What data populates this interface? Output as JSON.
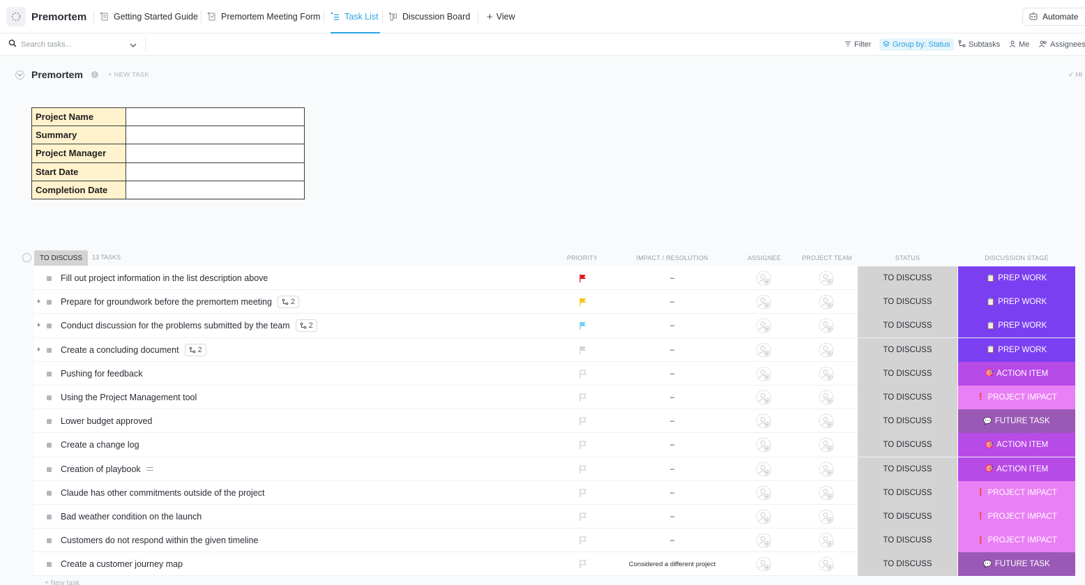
{
  "app": {
    "space_name": "Premortem",
    "tabs": [
      {
        "label": "Getting Started Guide",
        "icon": "doc-icon"
      },
      {
        "label": "Premortem Meeting Form",
        "icon": "form-icon"
      },
      {
        "label": "Task List",
        "icon": "list-icon",
        "active": true
      },
      {
        "label": "Discussion Board",
        "icon": "board-icon"
      }
    ],
    "add_view_label": "View",
    "automate_label": "Automate"
  },
  "toolbar": {
    "search_placeholder": "Search tasks...",
    "filter_label": "Filter",
    "group_by_label": "Group by: Status",
    "subtasks_label": "Subtasks",
    "me_label": "Me",
    "assignees_label": "Assignees"
  },
  "list": {
    "title": "Premortem",
    "new_task_label": "+ NEW TASK",
    "hide_label": "HI",
    "description_table": [
      {
        "label": "Project Name",
        "value": ""
      },
      {
        "label": "Summary",
        "value": ""
      },
      {
        "label": "Project Manager",
        "value": ""
      },
      {
        "label": "Start Date",
        "value": ""
      },
      {
        "label": "Completion Date",
        "value": ""
      }
    ]
  },
  "group": {
    "name": "TO DISCUSS",
    "count_label": "13 TASKS",
    "status_color": "#d3d3d3",
    "columns": {
      "priority": "PRIORITY",
      "impact": "IMPACT / RESOLUTION",
      "assignee": "ASSIGNEE",
      "team": "PROJECT TEAM",
      "status": "STATUS",
      "stage": "DISCUSSION STAGE"
    },
    "new_task_label": "+ New task"
  },
  "stage_styles": {
    "PREP WORK": {
      "color": "#7b3ff2",
      "icon": "📋"
    },
    "ACTION ITEM": {
      "color": "#b84ae8",
      "icon": "🎯"
    },
    "PROJECT IMPACT": {
      "color": "#ea80f5",
      "icon": "❗"
    },
    "FUTURE TASK": {
      "color": "#9b59b6",
      "icon": "💬"
    }
  },
  "priority_colors": {
    "urgent": "#e11d1d",
    "high": "#f5c518",
    "normal": "#6fd4f5",
    "low": "#d0d4da",
    "none": "#c4c9d0"
  },
  "tasks": [
    {
      "name": "Fill out project information in the list description above",
      "expandable": false,
      "subtasks": "",
      "priority": "urgent",
      "impact": "–",
      "status": "TO DISCUSS",
      "stage": "PREP WORK"
    },
    {
      "name": "Prepare for groundwork before the premortem meeting",
      "expandable": true,
      "subtasks": "2",
      "priority": "high",
      "impact": "–",
      "status": "TO DISCUSS",
      "stage": "PREP WORK"
    },
    {
      "name": "Conduct discussion for the problems submitted by the team",
      "expandable": true,
      "subtasks": "2",
      "priority": "normal",
      "impact": "–",
      "status": "TO DISCUSS",
      "stage": "PREP WORK"
    },
    {
      "name": "Create a concluding document",
      "expandable": true,
      "subtasks": "2",
      "priority": "low",
      "impact": "–",
      "status": "TO DISCUSS",
      "stage": "PREP WORK"
    },
    {
      "name": "Pushing for feedback",
      "expandable": false,
      "subtasks": "",
      "priority": "none",
      "impact": "–",
      "status": "TO DISCUSS",
      "stage": "ACTION ITEM"
    },
    {
      "name": "Using the Project Management tool",
      "expandable": false,
      "subtasks": "",
      "priority": "none",
      "impact": "–",
      "status": "TO DISCUSS",
      "stage": "PROJECT IMPACT"
    },
    {
      "name": "Lower budget approved",
      "expandable": false,
      "subtasks": "",
      "priority": "none",
      "impact": "–",
      "status": "TO DISCUSS",
      "stage": "FUTURE TASK"
    },
    {
      "name": "Create a change log",
      "expandable": false,
      "subtasks": "",
      "priority": "none",
      "impact": "–",
      "status": "TO DISCUSS",
      "stage": "ACTION ITEM"
    },
    {
      "name": "Creation of playbook",
      "expandable": false,
      "subtasks": "",
      "has_description": true,
      "priority": "none",
      "impact": "–",
      "status": "TO DISCUSS",
      "stage": "ACTION ITEM"
    },
    {
      "name": "Claude has other commitments outside of the project",
      "expandable": false,
      "subtasks": "",
      "priority": "none",
      "impact": "–",
      "status": "TO DISCUSS",
      "stage": "PROJECT IMPACT"
    },
    {
      "name": "Bad weather condition on the launch",
      "expandable": false,
      "subtasks": "",
      "priority": "none",
      "impact": "–",
      "status": "TO DISCUSS",
      "stage": "PROJECT IMPACT"
    },
    {
      "name": "Customers do not respond within the given timeline",
      "expandable": false,
      "subtasks": "",
      "priority": "none",
      "impact": "–",
      "status": "TO DISCUSS",
      "stage": "PROJECT IMPACT"
    },
    {
      "name": "Create a customer journey map",
      "expandable": false,
      "subtasks": "",
      "priority": "none",
      "impact": "Considered a different project",
      "status": "TO DISCUSS",
      "stage": "FUTURE TASK"
    }
  ]
}
